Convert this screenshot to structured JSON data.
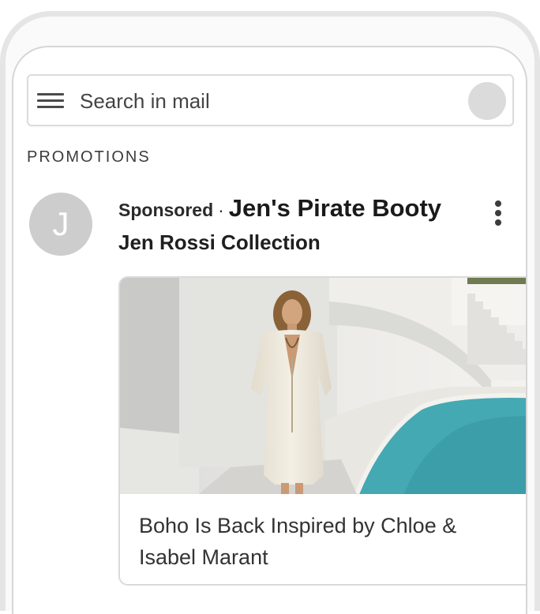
{
  "search": {
    "placeholder": "Search in mail"
  },
  "section": {
    "label": "PROMOTIONS"
  },
  "ad": {
    "avatar_letter": "J",
    "sponsored_label": "Sponsored",
    "separator": "·",
    "sender": "Jen's Pirate Booty",
    "subject": "Jen Rossi Collection",
    "caption": "Boho Is Back Inspired by Chloe & Isabel Marant"
  },
  "icons": {
    "menu": "hamburger-menu-icon",
    "more": "more-vert-icon"
  },
  "colors": {
    "avatar_bg": "#cdcdcd",
    "profile_bg": "#dbdbdb",
    "pool": "#3fa7b0"
  }
}
